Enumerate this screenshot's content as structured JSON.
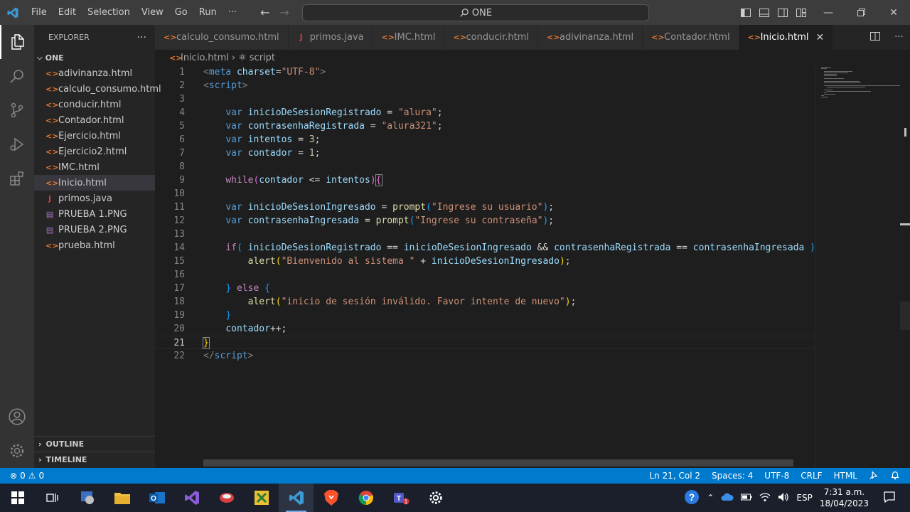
{
  "titlebar": {
    "menu": [
      "File",
      "Edit",
      "Selection",
      "View",
      "Go",
      "Run",
      "···"
    ],
    "search": "ONE"
  },
  "sidebar": {
    "title": "EXPLORER",
    "more": "···",
    "folder": "ONE",
    "files": [
      {
        "name": "adivinanza.html",
        "type": "html"
      },
      {
        "name": "calculo_consumo.html",
        "type": "html"
      },
      {
        "name": "conducir.html",
        "type": "html"
      },
      {
        "name": "Contador.html",
        "type": "html"
      },
      {
        "name": "Ejercicio.html",
        "type": "html"
      },
      {
        "name": "Ejercicio2.html",
        "type": "html"
      },
      {
        "name": "IMC.html",
        "type": "html"
      },
      {
        "name": "Inicio.html",
        "type": "html"
      },
      {
        "name": "primos.java",
        "type": "java"
      },
      {
        "name": "PRUEBA 1.PNG",
        "type": "png"
      },
      {
        "name": "PRUEBA 2.PNG",
        "type": "png"
      },
      {
        "name": "prueba.html",
        "type": "html"
      }
    ],
    "selected": "Inicio.html",
    "outline": "OUTLINE",
    "timeline": "TIMELINE"
  },
  "tabs": [
    {
      "name": "calculo_consumo.html",
      "type": "html"
    },
    {
      "name": "primos.java",
      "type": "java"
    },
    {
      "name": "IMC.html",
      "type": "html"
    },
    {
      "name": "conducir.html",
      "type": "html"
    },
    {
      "name": "adivinanza.html",
      "type": "html"
    },
    {
      "name": "Contador.html",
      "type": "html"
    },
    {
      "name": "Inicio.html",
      "type": "html",
      "active": true
    }
  ],
  "breadcrumb": {
    "file": "Inicio.html",
    "symbol": "script"
  },
  "editor": {
    "current_line": 21,
    "lines": [
      {
        "n": 1,
        "tokens": [
          [
            "t",
            "<"
          ],
          [
            "k",
            "meta"
          ],
          [
            "v",
            " charset"
          ],
          [
            "",
            "="
          ],
          [
            "s",
            "\"UTF-8\""
          ],
          [
            "t",
            ">"
          ]
        ]
      },
      {
        "n": 2,
        "tokens": [
          [
            "t",
            "<"
          ],
          [
            "k",
            "script"
          ],
          [
            "t",
            ">"
          ]
        ]
      },
      {
        "n": 3,
        "tokens": []
      },
      {
        "n": 4,
        "tokens": [
          [
            "",
            "    "
          ],
          [
            "k",
            "var"
          ],
          [
            "",
            " "
          ],
          [
            "v",
            "inicioDeSesionRegistrado"
          ],
          [
            "",
            " = "
          ],
          [
            "s",
            "\"alura\""
          ],
          [
            "",
            ";"
          ]
        ]
      },
      {
        "n": 5,
        "tokens": [
          [
            "",
            "    "
          ],
          [
            "k",
            "var"
          ],
          [
            "",
            " "
          ],
          [
            "v",
            "contrasenhaRegistrada"
          ],
          [
            "",
            " = "
          ],
          [
            "s",
            "\"alura321\""
          ],
          [
            "",
            ";"
          ]
        ]
      },
      {
        "n": 6,
        "tokens": [
          [
            "",
            "    "
          ],
          [
            "k",
            "var"
          ],
          [
            "",
            " "
          ],
          [
            "v",
            "intentos"
          ],
          [
            "",
            " = "
          ],
          [
            "n",
            "3"
          ],
          [
            "",
            ";"
          ]
        ]
      },
      {
        "n": 7,
        "tokens": [
          [
            "",
            "    "
          ],
          [
            "k",
            "var"
          ],
          [
            "",
            " "
          ],
          [
            "v",
            "contador"
          ],
          [
            "",
            " = "
          ],
          [
            "n",
            "1"
          ],
          [
            "",
            ";"
          ]
        ]
      },
      {
        "n": 8,
        "tokens": []
      },
      {
        "n": 9,
        "tokens": [
          [
            "",
            "    "
          ],
          [
            "c",
            "while"
          ],
          [
            "b2",
            "("
          ],
          [
            "v",
            "contador"
          ],
          [
            "",
            " <= "
          ],
          [
            "v",
            "intentos"
          ],
          [
            "b2",
            ")"
          ],
          [
            "b2 bm",
            "{"
          ]
        ]
      },
      {
        "n": 10,
        "tokens": []
      },
      {
        "n": 11,
        "tokens": [
          [
            "",
            "    "
          ],
          [
            "k",
            "var"
          ],
          [
            "",
            " "
          ],
          [
            "v",
            "inicioDeSesionIngresado"
          ],
          [
            "",
            " = "
          ],
          [
            "f",
            "prompt"
          ],
          [
            "b3",
            "("
          ],
          [
            "s",
            "\"Ingrese su usuario\""
          ],
          [
            "b3",
            ")"
          ],
          [
            "",
            ";"
          ]
        ]
      },
      {
        "n": 12,
        "tokens": [
          [
            "",
            "    "
          ],
          [
            "k",
            "var"
          ],
          [
            "",
            " "
          ],
          [
            "v",
            "contrasenhaIngresada"
          ],
          [
            "",
            " = "
          ],
          [
            "f",
            "prompt"
          ],
          [
            "b3",
            "("
          ],
          [
            "s",
            "\"Ingrese su contraseña\""
          ],
          [
            "b3",
            ")"
          ],
          [
            "",
            ";"
          ]
        ]
      },
      {
        "n": 13,
        "tokens": []
      },
      {
        "n": 14,
        "tokens": [
          [
            "",
            "    "
          ],
          [
            "c",
            "if"
          ],
          [
            "b3",
            "("
          ],
          [
            "",
            " "
          ],
          [
            "v",
            "inicioDeSesionRegistrado"
          ],
          [
            "",
            " == "
          ],
          [
            "v",
            "inicioDeSesionIngresado"
          ],
          [
            "",
            " && "
          ],
          [
            "v",
            "contrasenhaRegistrada"
          ],
          [
            "",
            " == "
          ],
          [
            "v",
            "contrasenhaIngresada"
          ],
          [
            "",
            " "
          ],
          [
            "b3",
            ")"
          ],
          [
            "",
            " "
          ],
          [
            "b3",
            "{"
          ]
        ]
      },
      {
        "n": 15,
        "tokens": [
          [
            "",
            "        "
          ],
          [
            "f",
            "alert"
          ],
          [
            "b1",
            "("
          ],
          [
            "s",
            "\"Bienvenido al sistema \""
          ],
          [
            "",
            " + "
          ],
          [
            "v",
            "inicioDeSesionIngresado"
          ],
          [
            "b1",
            ")"
          ],
          [
            "",
            ";"
          ]
        ]
      },
      {
        "n": 16,
        "tokens": []
      },
      {
        "n": 17,
        "tokens": [
          [
            "",
            "    "
          ],
          [
            "b3",
            "}"
          ],
          [
            "",
            " "
          ],
          [
            "c",
            "else"
          ],
          [
            "",
            " "
          ],
          [
            "b3",
            "{"
          ]
        ]
      },
      {
        "n": 18,
        "tokens": [
          [
            "",
            "        "
          ],
          [
            "f",
            "alert"
          ],
          [
            "b1",
            "("
          ],
          [
            "s",
            "\"inicio de sesión inválido. Favor intente de nuevo\""
          ],
          [
            "b1",
            ")"
          ],
          [
            "",
            ";"
          ]
        ]
      },
      {
        "n": 19,
        "tokens": [
          [
            "",
            "    "
          ],
          [
            "b3",
            "}"
          ]
        ]
      },
      {
        "n": 20,
        "tokens": [
          [
            "",
            "    "
          ],
          [
            "v",
            "contador"
          ],
          [
            "",
            "++;"
          ]
        ]
      },
      {
        "n": 21,
        "tokens": [
          [
            "b1 bm",
            "}"
          ]
        ]
      },
      {
        "n": 22,
        "tokens": [
          [
            "t",
            "</"
          ],
          [
            "k",
            "script"
          ],
          [
            "t",
            ">"
          ]
        ]
      }
    ]
  },
  "statusbar": {
    "errors": "0",
    "warnings": "0",
    "position": "Ln 21, Col 2",
    "spaces": "Spaces: 4",
    "encoding": "UTF-8",
    "eol": "CRLF",
    "language": "HTML"
  },
  "taskbar": {
    "language": "ESP",
    "time": "7:31 a.m.",
    "date": "18/04/2023"
  }
}
